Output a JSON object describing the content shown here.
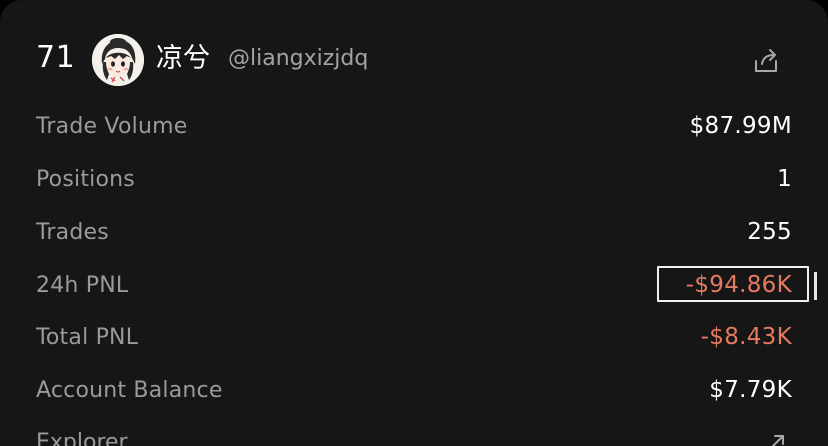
{
  "profile": {
    "rank": "71",
    "display_name": "凉兮",
    "handle": "@liangxizjdq",
    "avatar_icon": "anime-avatar",
    "share_icon": "share-icon"
  },
  "stats": [
    {
      "label": "Trade Volume",
      "value": "$87.99M",
      "tone": "neutral"
    },
    {
      "label": "Positions",
      "value": "1",
      "tone": "neutral"
    },
    {
      "label": "Trades",
      "value": "255",
      "tone": "neutral"
    },
    {
      "label": "24h PNL",
      "value": "-$94.86K",
      "tone": "negative"
    },
    {
      "label": "Total PNL",
      "value": "-$8.43K",
      "tone": "negative"
    },
    {
      "label": "Account Balance",
      "value": "$7.79K",
      "tone": "neutral"
    }
  ],
  "explorer": {
    "label": "Explorer",
    "icon": "external-link-icon"
  },
  "colors": {
    "background": "#161616",
    "label": "#9a9a9a",
    "value": "#ffffff",
    "negative": "#e57a61"
  }
}
